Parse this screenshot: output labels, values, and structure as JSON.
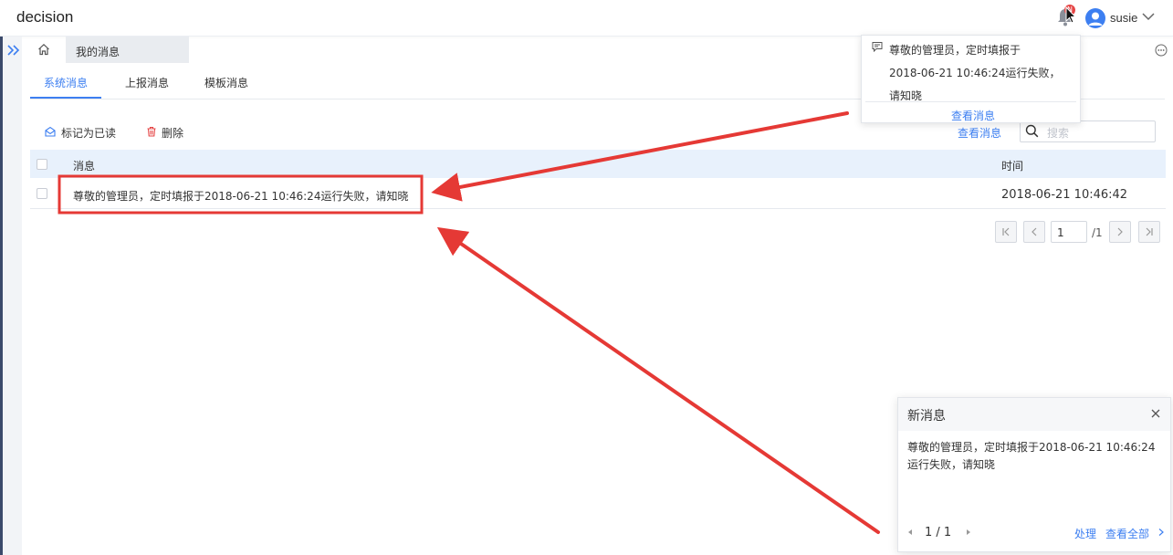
{
  "app": {
    "brand": "decision"
  },
  "header": {
    "username": "susie",
    "notification_badge": "N"
  },
  "breadcrumb": {
    "current_tab": "我的消息"
  },
  "subtabs": [
    {
      "label": "系统消息",
      "active": true
    },
    {
      "label": "上报消息",
      "active": false
    },
    {
      "label": "模板消息",
      "active": false
    }
  ],
  "toolbar": {
    "mark_read_label": "标记为已读",
    "delete_label": "删除",
    "view_message_label": "查看消息",
    "search_placeholder": "搜索"
  },
  "table": {
    "headers": {
      "message": "消息",
      "time": "时间"
    },
    "rows": [
      {
        "message": "尊敬的管理员，定时填报于2018-06-21 10:46:24运行失败，请知晓",
        "time": "2018-06-21 10:46:42"
      }
    ]
  },
  "pagination": {
    "current_page": "1",
    "total_label": "/1"
  },
  "popup": {
    "lines": [
      "尊敬的管理员，定时填报于",
      "2018-06-21 10:46:24运行失败，",
      "请知晓"
    ],
    "link_label": "查看消息"
  },
  "new_message_panel": {
    "title": "新消息",
    "body_line1": "尊敬的管理员，定时填报于2018-06-21 10:46:24",
    "body_line2": "运行失败，请知晓",
    "page_indicator": "1 / 1",
    "handle_label": "处理",
    "view_all_label": "查看全部"
  },
  "colors": {
    "accent": "#3d7ff1",
    "annotation": "#e53935",
    "header_row_bg": "#e8f1fc"
  }
}
